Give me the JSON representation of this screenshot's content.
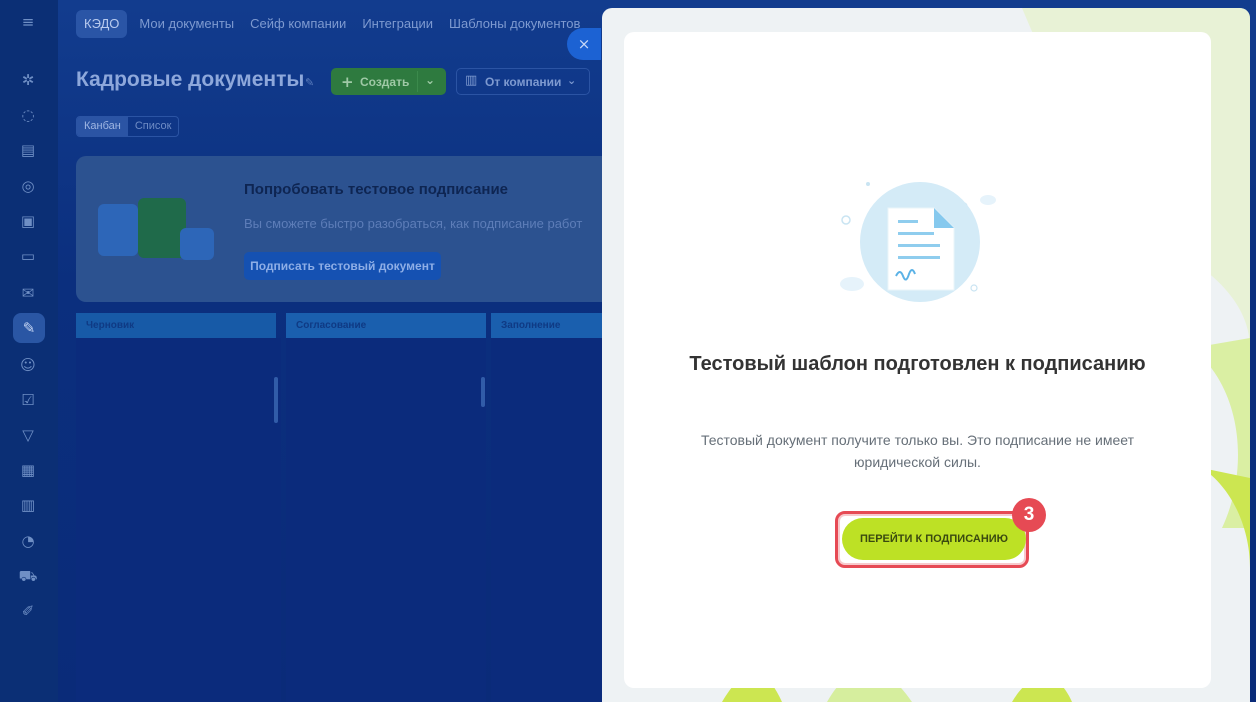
{
  "left_rail": {
    "menu_icon": "≡",
    "icons": [
      "chat-icon",
      "comments-icon",
      "feed-icon",
      "settings-icon",
      "calendar-icon",
      "card-icon",
      "mail-icon",
      "document-sign-icon",
      "user-icon",
      "tasks-icon",
      "filter-icon",
      "schedule-icon",
      "storage-icon",
      "analytics-icon",
      "cart-icon",
      "edit-icon"
    ]
  },
  "topnav": {
    "tabs": [
      "КЭДО",
      "Мои документы",
      "Сейф компании",
      "Интеграции",
      "Шаблоны документов"
    ]
  },
  "page": {
    "title": "Кадровые документы",
    "create_label": "Создать",
    "company_label": "От компании",
    "views": [
      "Канбан",
      "Список"
    ]
  },
  "promo": {
    "title": "Попробовать тестовое подписание",
    "text": "Вы сможете быстро разобраться, как подписание работ",
    "button": "Подписать тестовый документ"
  },
  "kanban": {
    "columns": [
      "Черновик",
      "Согласование",
      "Заполнение"
    ]
  },
  "modal": {
    "title": "Тестовый шаблон подготовлен к подписанию",
    "text": "Тестовый документ получите только вы. Это подписание не имеет юридической силы.",
    "cta": "ПЕРЕЙТИ К ПОДПИСАНИЮ",
    "step_number": "3",
    "close": "×"
  },
  "colors": {
    "accent_green": "#bde125",
    "highlight_red": "#e64a54",
    "overlay_blue": "#0c2f78"
  }
}
